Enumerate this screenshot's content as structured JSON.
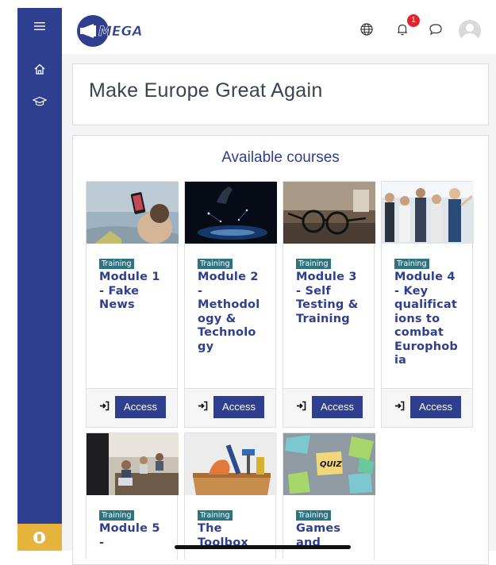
{
  "header": {
    "logo_text": "MEGA",
    "notification_count": "1",
    "icons": [
      "hamburger-icon",
      "globe-icon",
      "bell-icon",
      "chat-icon",
      "user-avatar"
    ]
  },
  "sidebar": {
    "items": [
      {
        "icon": "home-icon"
      },
      {
        "icon": "graduation-cap-icon"
      }
    ],
    "footer_icon": "accessibility-icon"
  },
  "page": {
    "title": "Make Europe Great Again"
  },
  "courses": {
    "heading": "Available courses",
    "access_label": "Access",
    "tag_label": "Training",
    "items": [
      {
        "name": "Module 1 - Fake News"
      },
      {
        "name": "Module 2 - Methodology & Technology"
      },
      {
        "name": "Module 3 - Self Testing & Training"
      },
      {
        "name": "Module 4 - Key qualifications to combat Europhobia"
      },
      {
        "name": "Module 5 -"
      },
      {
        "name": "The Toolbox"
      },
      {
        "name": "Games and"
      }
    ],
    "name_lines": [
      [
        "Module 1",
        "- Fake",
        "News"
      ],
      [
        "Module 2",
        "-",
        "Methodol",
        "ogy &",
        "Technolo",
        "gy"
      ],
      [
        "Module 3",
        "- Self",
        "Testing &",
        "Training"
      ],
      [
        "Module 4",
        "- Key",
        "qualificat",
        "ions to",
        "combat",
        "Europhob",
        "ia"
      ],
      [
        "Module 5",
        "-"
      ],
      [
        "The",
        "Toolbox"
      ],
      [
        "Games",
        "and"
      ]
    ],
    "image_overlay_text": "QUIZ"
  },
  "colors": {
    "sidebar": "#2f3f8f",
    "accent": "#2f3f8f",
    "tag": "#2d7380",
    "badge": "#e0262a",
    "accessibility": "#e6b43c"
  }
}
